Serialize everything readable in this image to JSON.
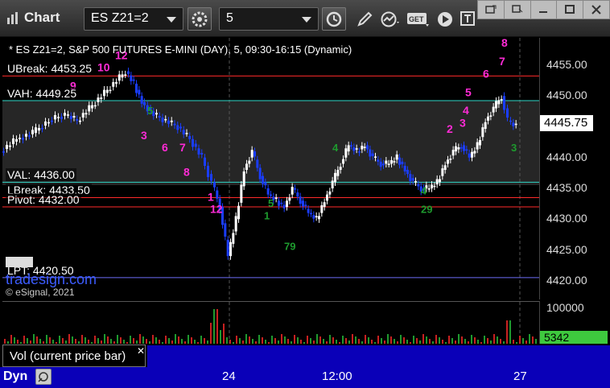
{
  "window": {
    "title": "Chart",
    "symbol": "ES Z21=2",
    "interval": "5"
  },
  "chart": {
    "header": "* ES Z21=2, S&P 500 FUTURES E-MINI (DAY), 5, 09:30-16:15 (Dynamic)",
    "levels": [
      {
        "label": "UBreak: 4453.25",
        "price": 4453.25,
        "color": "#ff2a2a"
      },
      {
        "label": "VAH: 4449.25",
        "price": 4449.25,
        "color": "#2fd6c6"
      },
      {
        "label": "VAL: 4436.00",
        "price": 4436.0,
        "color": "#2fd6c6"
      },
      {
        "label": "LBreak: 4433.50",
        "price": 4433.5,
        "color": "#ff2a2a"
      },
      {
        "label": "Pivot: 4432.00",
        "price": 4432.0,
        "color": "#ff2a2a"
      },
      {
        "label": "LPT: 4420.50",
        "price": 4420.5,
        "color": "#6e6ef5"
      }
    ],
    "brand": "tradesign.com",
    "copyright": "© eSignal, 2021",
    "current_price": "4445.75"
  },
  "price_axis": {
    "ticks": [
      "4455.00",
      "4450.00",
      "4445.00",
      "4440.00",
      "4435.00",
      "4430.00",
      "4425.00",
      "4420.00"
    ]
  },
  "volume": {
    "max_label": "100000",
    "current": "5342",
    "legend": "Vol (current price bar)"
  },
  "x_axis": {
    "ticks": [
      "24",
      "12:00",
      "27"
    ],
    "mode": "Dyn"
  },
  "colors": {
    "up_bar": "#ffffff",
    "down_bar": "#1a3dff",
    "td_magenta": "#ff2bd6",
    "td_green": "#1e9a2e",
    "axis_blue": "#0a00b8"
  }
}
